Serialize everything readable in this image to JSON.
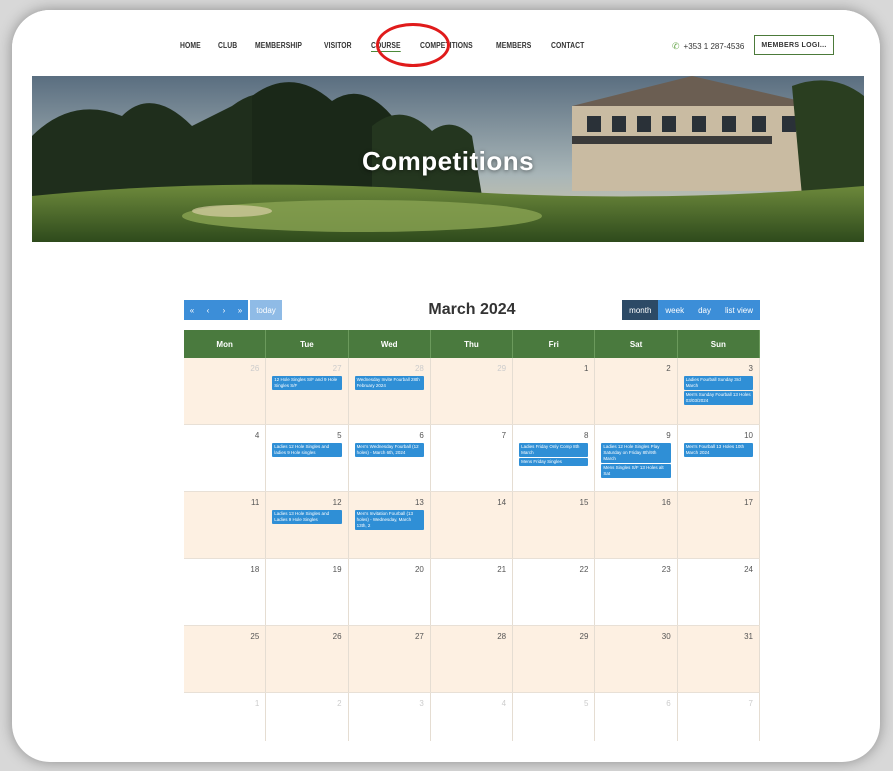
{
  "nav": {
    "items": [
      {
        "label": "HOME",
        "active": false
      },
      {
        "label": "CLUB",
        "active": false
      },
      {
        "label": "MEMBERSHIP",
        "active": false
      },
      {
        "label": "VISITOR",
        "active": false
      },
      {
        "label": "COURSE",
        "active": true
      },
      {
        "label": "COMPETITIONS",
        "active": false
      },
      {
        "label": "MEMBERS",
        "active": false
      },
      {
        "label": "CONTACT",
        "active": false
      }
    ],
    "phone": "+353 1 287-4536",
    "members_login": "MEMBERS LOGI..."
  },
  "hero": {
    "title": "Competitions"
  },
  "toolbar": {
    "prev_year": "«",
    "prev": "‹",
    "next": "›",
    "next_year": "»",
    "today": "today",
    "title": "March 2024",
    "views": [
      {
        "label": "month",
        "active": true
      },
      {
        "label": "week",
        "active": false
      },
      {
        "label": "day",
        "active": false
      },
      {
        "label": "list view",
        "active": false
      }
    ]
  },
  "calendar": {
    "weekdays": [
      "Mon",
      "Tue",
      "Wed",
      "Thu",
      "Fri",
      "Sat",
      "Sun"
    ],
    "weeks": [
      [
        {
          "day": "26",
          "other": true,
          "events": []
        },
        {
          "day": "27",
          "other": true,
          "events": [
            "12 Hole Singles S/F and 9 Hole Singles S/F"
          ]
        },
        {
          "day": "28",
          "other": true,
          "events": [
            "Wednesday Invite Fourball 28th February 2024"
          ]
        },
        {
          "day": "29",
          "other": true,
          "events": []
        },
        {
          "day": "1",
          "other": false,
          "events": []
        },
        {
          "day": "2",
          "other": false,
          "events": []
        },
        {
          "day": "3",
          "other": false,
          "events": [
            "Ladies Fourball Sunday 3rd March",
            "Men's Sunday Fourball 13 Holes 03/03/2024"
          ]
        }
      ],
      [
        {
          "day": "4",
          "other": false,
          "events": []
        },
        {
          "day": "5",
          "other": false,
          "events": [
            "Ladies 12 Hole Singles and ladies 9 Hole singles"
          ]
        },
        {
          "day": "6",
          "other": false,
          "events": [
            "Men's Wednesday Fourball (12 holes) - March 6th, 2024"
          ]
        },
        {
          "day": "7",
          "other": false,
          "events": []
        },
        {
          "day": "8",
          "other": false,
          "events": [
            "Ladies Friday Only Comp 8th March",
            "Mens Friday Singles"
          ]
        },
        {
          "day": "9",
          "other": false,
          "events": [
            "Ladies 12 Hole Singles Play Saturday on Friday 8th/9th March",
            "Mens Singles S/F 13 Holes alt Sat"
          ]
        },
        {
          "day": "10",
          "other": false,
          "events": [
            "Men's Fourball 13 Holes 10th March 2024"
          ]
        }
      ],
      [
        {
          "day": "11",
          "other": false,
          "events": []
        },
        {
          "day": "12",
          "other": false,
          "events": [
            "Ladies 13 Hole Singles and Ladies 9 Hole Singles"
          ]
        },
        {
          "day": "13",
          "other": false,
          "events": [
            "Men's Invitation Fourball (13 holes) - Wednesday, March 13th, 2"
          ]
        },
        {
          "day": "14",
          "other": false,
          "events": []
        },
        {
          "day": "15",
          "other": false,
          "events": []
        },
        {
          "day": "16",
          "other": false,
          "events": []
        },
        {
          "day": "17",
          "other": false,
          "events": []
        }
      ],
      [
        {
          "day": "18",
          "other": false,
          "events": []
        },
        {
          "day": "19",
          "other": false,
          "events": []
        },
        {
          "day": "20",
          "other": false,
          "events": []
        },
        {
          "day": "21",
          "other": false,
          "events": []
        },
        {
          "day": "22",
          "other": false,
          "events": []
        },
        {
          "day": "23",
          "other": false,
          "events": []
        },
        {
          "day": "24",
          "other": false,
          "events": []
        }
      ],
      [
        {
          "day": "25",
          "other": false,
          "events": []
        },
        {
          "day": "26",
          "other": false,
          "events": []
        },
        {
          "day": "27",
          "other": false,
          "events": []
        },
        {
          "day": "28",
          "other": false,
          "events": []
        },
        {
          "day": "29",
          "other": false,
          "events": []
        },
        {
          "day": "30",
          "other": false,
          "events": []
        },
        {
          "day": "31",
          "other": false,
          "events": []
        }
      ],
      [
        {
          "day": "1",
          "other": true,
          "events": []
        },
        {
          "day": "2",
          "other": true,
          "events": []
        },
        {
          "day": "3",
          "other": true,
          "events": []
        },
        {
          "day": "4",
          "other": true,
          "events": []
        },
        {
          "day": "5",
          "other": true,
          "events": []
        },
        {
          "day": "6",
          "other": true,
          "events": []
        },
        {
          "day": "7",
          "other": true,
          "events": []
        }
      ]
    ]
  },
  "colors": {
    "accent_green": "#4a7a3e",
    "event_blue": "#2f8fd6",
    "highlight_red": "#e01b1b",
    "shade_row": "#fdf0e2"
  }
}
